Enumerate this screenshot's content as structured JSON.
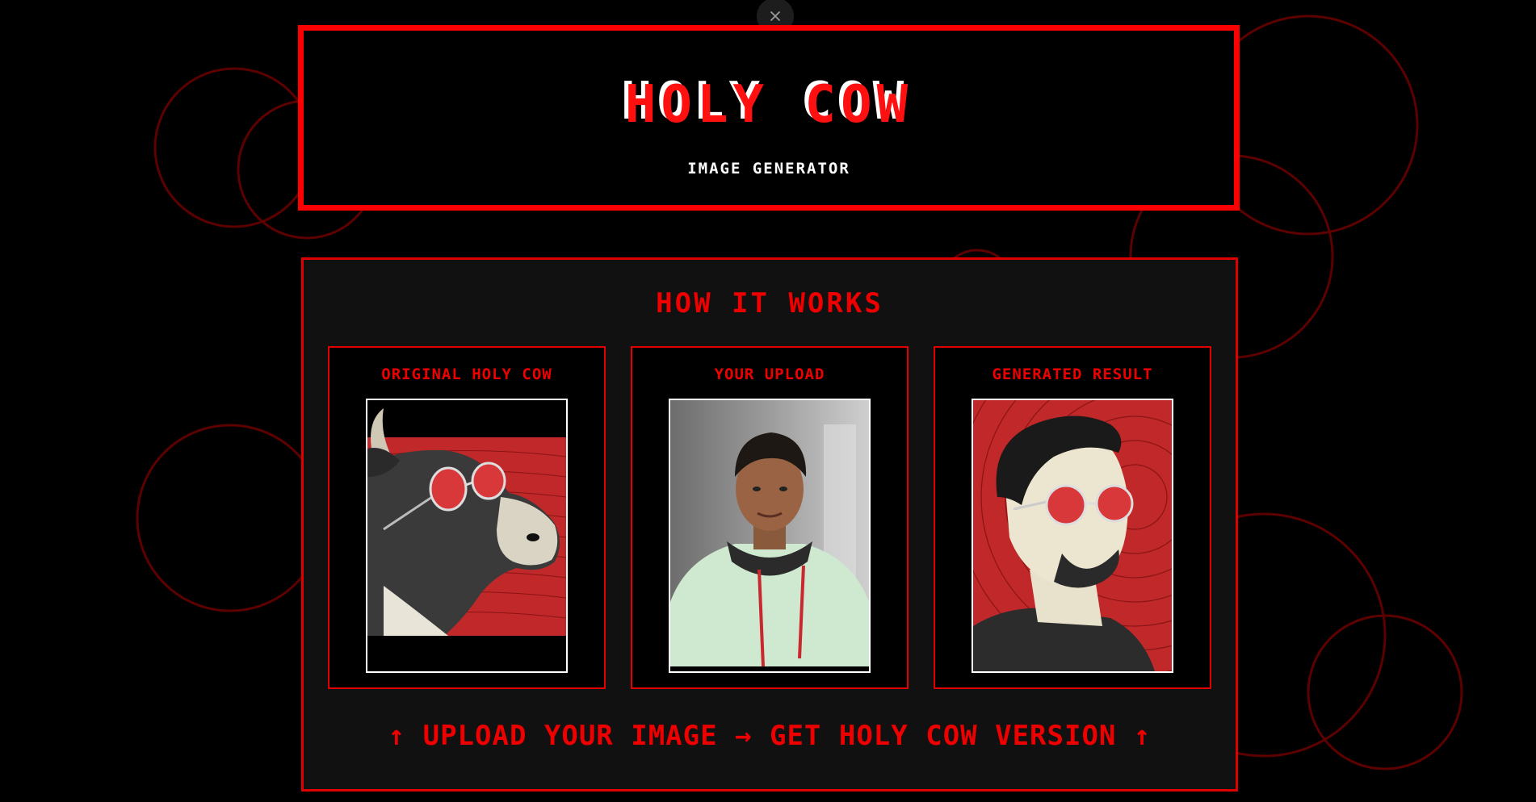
{
  "header": {
    "title": "HOLY COW",
    "subtitle": "IMAGE GENERATOR"
  },
  "close_icon": "close-icon",
  "how_it_works": {
    "title": "HOW IT WORKS",
    "steps": [
      {
        "label": "ORIGINAL HOLY COW",
        "image": "cow-with-red-sunglasses-illustration"
      },
      {
        "label": "YOUR UPLOAD",
        "image": "user-selfie-photo"
      },
      {
        "label": "GENERATED RESULT",
        "image": "man-with-red-sunglasses-illustration"
      }
    ],
    "cta": "↑ UPLOAD YOUR IMAGE → GET HOLY COW VERSION ↑"
  },
  "colors": {
    "accent": "#ff0000",
    "background": "#000000",
    "panel": "#111111",
    "text_light": "#ffffff",
    "decor_circle": "#5a0000"
  }
}
